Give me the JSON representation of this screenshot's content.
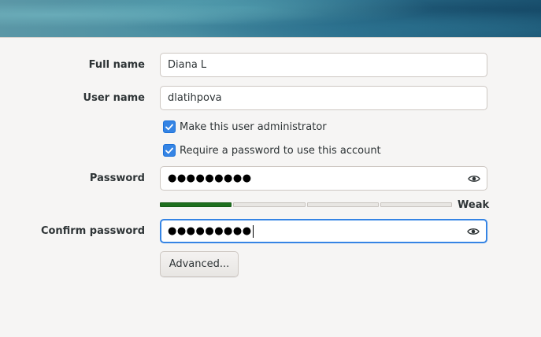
{
  "form": {
    "full_name": {
      "label": "Full name",
      "value": "Diana L"
    },
    "user_name": {
      "label": "User name",
      "value": "dlatihpova"
    },
    "admin_checkbox": {
      "label": "Make this user administrator",
      "checked": true
    },
    "require_password_checkbox": {
      "label": "Require a password to use this account",
      "checked": true
    },
    "password": {
      "label": "Password",
      "masked_value": "●●●●●●●●●"
    },
    "strength": {
      "label": "Weak",
      "level_fraction": 0.25,
      "segments": 4,
      "filled_segments": 1,
      "color": "#1e6f1e"
    },
    "confirm_password": {
      "label": "Confirm password",
      "masked_value": "●●●●●●●●●"
    },
    "advanced_button": {
      "label": "Advanced..."
    }
  },
  "colors": {
    "accent": "#3584e4",
    "background": "#f6f5f4",
    "strength_fill": "#1e6f1e"
  },
  "icons": {
    "password_reveal": "eye-icon",
    "checkbox_check": "checkmark-icon"
  }
}
